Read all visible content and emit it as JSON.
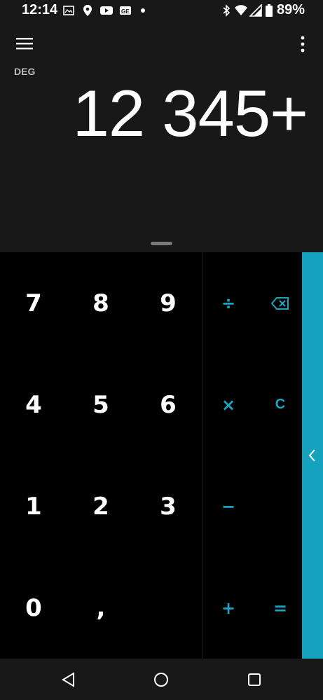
{
  "status_bar": {
    "time": "12:14",
    "battery": "89%",
    "icons": [
      "gallery-icon",
      "location-icon",
      "youtube-icon",
      "news-icon",
      "notification-dot",
      "bluetooth-icon",
      "wifi-icon",
      "signal-icon",
      "battery-icon"
    ]
  },
  "display": {
    "angle_mode": "DEG",
    "expression": "12 345+"
  },
  "keypad": {
    "digits": [
      "7",
      "8",
      "9",
      "4",
      "5",
      "6",
      "1",
      "2",
      "3",
      "0",
      ","
    ],
    "operators": {
      "divide": "÷",
      "multiply": "×",
      "minus": "−",
      "plus": "+",
      "equals": "=",
      "clear": "C"
    }
  },
  "colors": {
    "accent": "#14a2bf",
    "operator_text": "#19a3c1",
    "display_bg": "#181818",
    "keypad_bg": "#000000"
  }
}
